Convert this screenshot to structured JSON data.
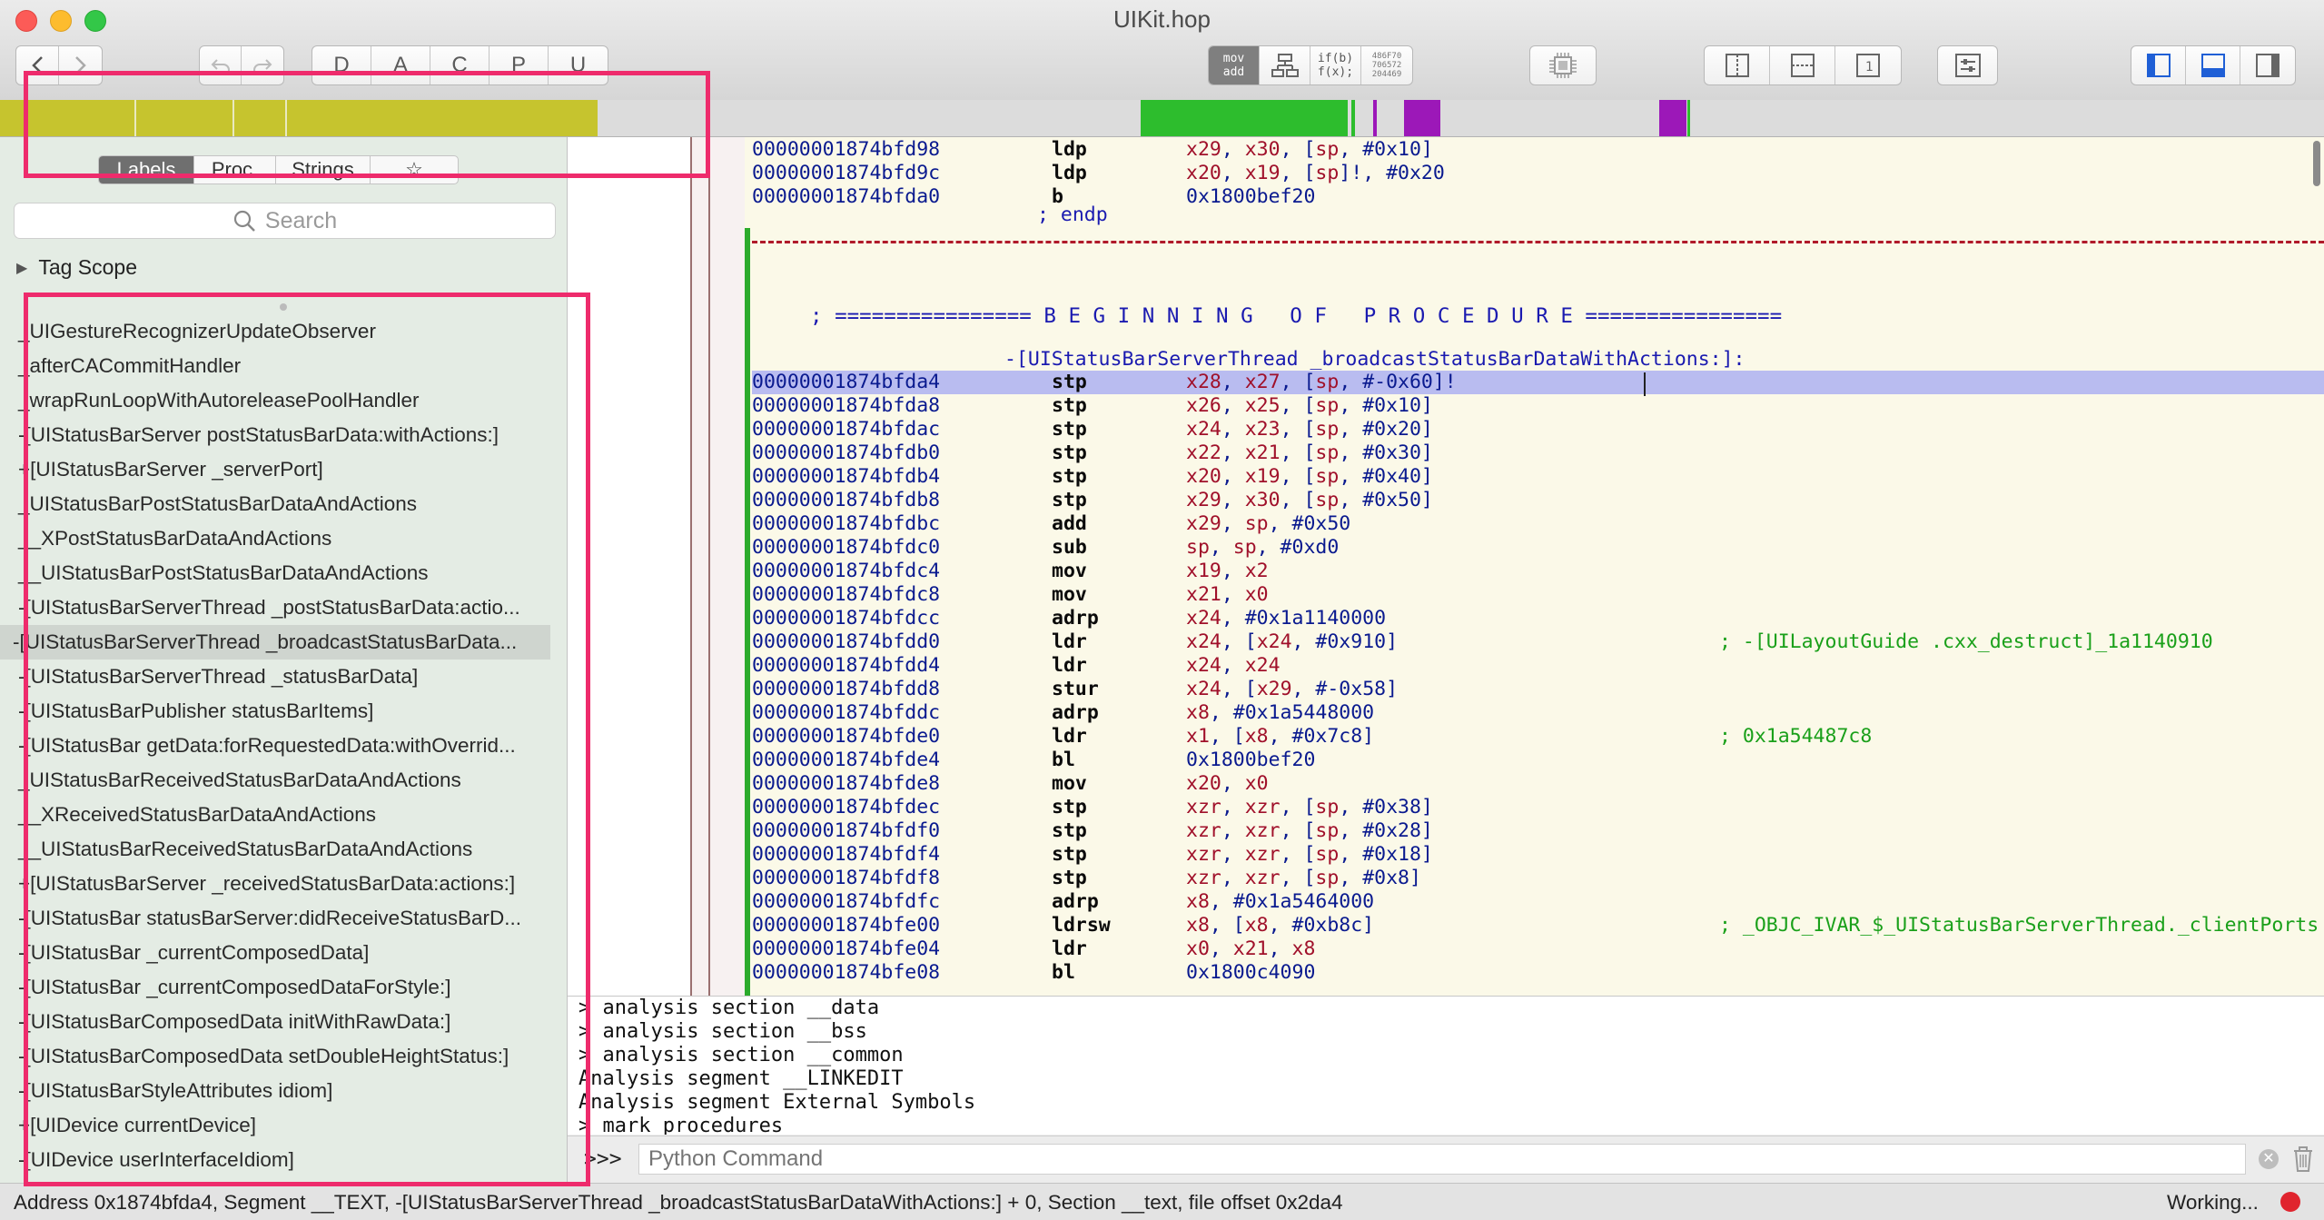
{
  "window": {
    "title": "UIKit.hop"
  },
  "toolbar": {
    "letters": [
      "D",
      "A",
      "C",
      "P",
      "U"
    ],
    "mode_mov": "mov",
    "mode_add": "add",
    "mode_if": "if(b)",
    "mode_fx": "f(x);",
    "mode_hex": [
      "486F70",
      "706572",
      "204469"
    ]
  },
  "sidebar": {
    "tabs": [
      "Labels",
      "Proc.",
      "Strings",
      "☆"
    ],
    "search_placeholder": "Search",
    "tag_scope": "Tag Scope",
    "items": [
      "_UIGestureRecognizerUpdateObserver",
      "_afterCACommitHandler",
      "_wrapRunLoopWithAutoreleasePoolHandler",
      "-[UIStatusBarServer postStatusBarData:withActions:]",
      "+[UIStatusBarServer _serverPort]",
      "_UIStatusBarPostStatusBarDataAndActions",
      "__XPostStatusBarDataAndActions",
      "__UIStatusBarPostStatusBarDataAndActions",
      "-[UIStatusBarServerThread _postStatusBarData:actio...",
      "-[UIStatusBarServerThread _broadcastStatusBarData...",
      "-[UIStatusBarServerThread _statusBarData]",
      "-[UIStatusBarPublisher statusBarItems]",
      "-[UIStatusBar getData:forRequestedData:withOverrid...",
      "_UIStatusBarReceivedStatusBarDataAndActions",
      "__XReceivedStatusBarDataAndActions",
      "__UIStatusBarReceivedStatusBarDataAndActions",
      "+[UIStatusBarServer _receivedStatusBarData:actions:]",
      "-[UIStatusBar statusBarServer:didReceiveStatusBarD...",
      "-[UIStatusBar _currentComposedData]",
      "-[UIStatusBar _currentComposedDataForStyle:]",
      "-[UIStatusBarComposedData initWithRawData:]",
      "-[UIStatusBarComposedData setDoubleHeightStatus:]",
      "-[UIStatusBarStyleAttributes idiom]",
      "+[UIDevice currentDevice]",
      "-[UIDevice userInterfaceIdiom]"
    ],
    "selected_index": 9
  },
  "asm": {
    "prev_rows": [
      {
        "addr": "00000001874bfd98",
        "mn": "ldp",
        "op": "x29, x30, [sp, #0x10]"
      },
      {
        "addr": "00000001874bfd9c",
        "mn": "ldp",
        "op": "x20, x19, [sp]!, #0x20"
      },
      {
        "addr": "00000001874bfda0",
        "mn": "b",
        "op": "0x1800bef20"
      }
    ],
    "endp": "; endp",
    "banner": "; ================ B E G I N N I N G   O F   P R O C E D U R E ================",
    "proc_name": "-[UIStatusBarServerThread _broadcastStatusBarDataWithActions:]:",
    "rows": [
      {
        "addr": "00000001874bfda4",
        "mn": "stp",
        "op": "x28, x27, [sp, #-0x60]!",
        "cm": ""
      },
      {
        "addr": "00000001874bfda8",
        "mn": "stp",
        "op": "x26, x25, [sp, #0x10]",
        "cm": ""
      },
      {
        "addr": "00000001874bfdac",
        "mn": "stp",
        "op": "x24, x23, [sp, #0x20]",
        "cm": ""
      },
      {
        "addr": "00000001874bfdb0",
        "mn": "stp",
        "op": "x22, x21, [sp, #0x30]",
        "cm": ""
      },
      {
        "addr": "00000001874bfdb4",
        "mn": "stp",
        "op": "x20, x19, [sp, #0x40]",
        "cm": ""
      },
      {
        "addr": "00000001874bfdb8",
        "mn": "stp",
        "op": "x29, x30, [sp, #0x50]",
        "cm": ""
      },
      {
        "addr": "00000001874bfdbc",
        "mn": "add",
        "op": "x29, sp, #0x50",
        "cm": ""
      },
      {
        "addr": "00000001874bfdc0",
        "mn": "sub",
        "op": "sp, sp, #0xd0",
        "cm": ""
      },
      {
        "addr": "00000001874bfdc4",
        "mn": "mov",
        "op": "x19, x2",
        "cm": ""
      },
      {
        "addr": "00000001874bfdc8",
        "mn": "mov",
        "op": "x21, x0",
        "cm": ""
      },
      {
        "addr": "00000001874bfdcc",
        "mn": "adrp",
        "op": "x24, #0x1a1140000",
        "cm": ""
      },
      {
        "addr": "00000001874bfdd0",
        "mn": "ldr",
        "op": "x24, [x24, #0x910]",
        "cm": "; -[UILayoutGuide .cxx_destruct]_1a1140910"
      },
      {
        "addr": "00000001874bfdd4",
        "mn": "ldr",
        "op": "x24, x24",
        "cm": ""
      },
      {
        "addr": "00000001874bfdd8",
        "mn": "stur",
        "op": "x24, [x29, #-0x58]",
        "cm": ""
      },
      {
        "addr": "00000001874bfddc",
        "mn": "adrp",
        "op": "x8, #0x1a5448000",
        "cm": ""
      },
      {
        "addr": "00000001874bfde0",
        "mn": "ldr",
        "op": "x1, [x8, #0x7c8]",
        "cm": "; 0x1a54487c8"
      },
      {
        "addr": "00000001874bfde4",
        "mn": "bl",
        "op": "0x1800bef20",
        "cm": ""
      },
      {
        "addr": "00000001874bfde8",
        "mn": "mov",
        "op": "x20, x0",
        "cm": ""
      },
      {
        "addr": "00000001874bfdec",
        "mn": "stp",
        "op": "xzr, xzr, [sp, #0x38]",
        "cm": ""
      },
      {
        "addr": "00000001874bfdf0",
        "mn": "stp",
        "op": "xzr, xzr, [sp, #0x28]",
        "cm": ""
      },
      {
        "addr": "00000001874bfdf4",
        "mn": "stp",
        "op": "xzr, xzr, [sp, #0x18]",
        "cm": ""
      },
      {
        "addr": "00000001874bfdf8",
        "mn": "stp",
        "op": "xzr, xzr, [sp, #0x8]",
        "cm": ""
      },
      {
        "addr": "00000001874bfdfc",
        "mn": "adrp",
        "op": "x8, #0x1a5464000",
        "cm": ""
      },
      {
        "addr": "00000001874bfe00",
        "mn": "ldrsw",
        "op": "x8, [x8, #0xb8c]",
        "cm": "; _OBJC_IVAR_$_UIStatusBarServerThread._clientPorts"
      },
      {
        "addr": "00000001874bfe04",
        "mn": "ldr",
        "op": "x0, x21, x8",
        "cm": ""
      },
      {
        "addr": "00000001874bfe08",
        "mn": "bl",
        "op": "0x1800c4090",
        "cm": ""
      }
    ],
    "highlighted_index": 0
  },
  "console": {
    "lines": [
      "> analysis section __data",
      "> analysis section __bss",
      "> analysis section __common",
      "Analysis segment __LINKEDIT",
      "Analysis segment External Symbols",
      "> mark procedures"
    ],
    "prompt": ">>>",
    "input_placeholder": "Python Command"
  },
  "status": {
    "text": "Address 0x1874bfda4, Segment __TEXT, -[UIStatusBarServerThread _broadcastStatusBarDataWithActions:] + 0, Section __text, file offset 0x2da4",
    "working": "Working..."
  },
  "colors": {
    "annotation": "#ee2b6c",
    "nav_yellow": "#c6c42e",
    "nav_green": "#2dbd2d",
    "nav_purple": "#9c18b8",
    "highlight": "#b9bcf0"
  }
}
